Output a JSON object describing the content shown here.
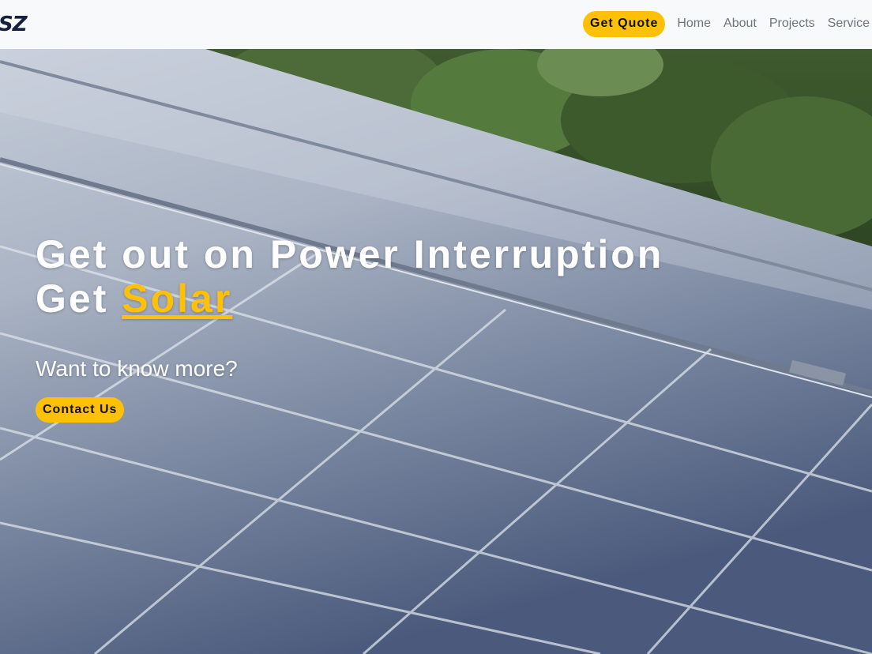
{
  "navbar": {
    "brand": "SZ",
    "quote_button": "Get Quote",
    "links": [
      "Home",
      "About",
      "Projects",
      "Service"
    ]
  },
  "hero": {
    "title_line1": "Get out on Power Interruption",
    "title_line2_prefix": "Get ",
    "title_line2_accent": "Solar",
    "subtitle": "Want to know more?",
    "contact_button": "Contact Us"
  },
  "colors": {
    "accent": "#ffc107",
    "nav_text": "#6c757d",
    "brand": "#15203f"
  }
}
